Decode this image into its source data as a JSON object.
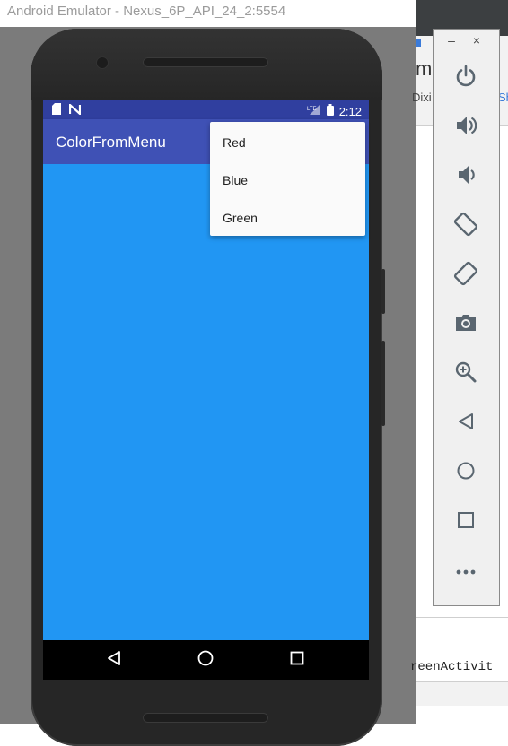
{
  "window": {
    "title": "Android Emulator - Nexus_6P_API_24_2:5554"
  },
  "status_bar": {
    "time": "2:12",
    "icons": [
      "sd-card-icon",
      "n-notification-icon",
      "lte-signal-icon",
      "battery-icon"
    ]
  },
  "app": {
    "title": "ColorFromMenu",
    "background_color": "#2196f3",
    "appbar_color": "#3f51b5",
    "statusbar_color": "#303f9f"
  },
  "menu": {
    "items": [
      {
        "label": "Red"
      },
      {
        "label": "Blue"
      },
      {
        "label": "Green"
      }
    ]
  },
  "nav_bar": {
    "buttons": [
      "back-icon",
      "home-icon",
      "recents-icon"
    ]
  },
  "toolbar": {
    "minimize_label": "–",
    "close_label": "×",
    "buttons": [
      "power-icon",
      "volume-up-icon",
      "volume-down-icon",
      "rotate-left-icon",
      "rotate-right-icon",
      "camera-icon",
      "zoom-icon",
      "back-icon",
      "home-icon",
      "overview-icon",
      "more-icon"
    ]
  },
  "ide": {
    "heading_fragment": "m",
    "text_left": "Dixi",
    "text_right": "Sb",
    "code_fragment": "reenActivit"
  }
}
